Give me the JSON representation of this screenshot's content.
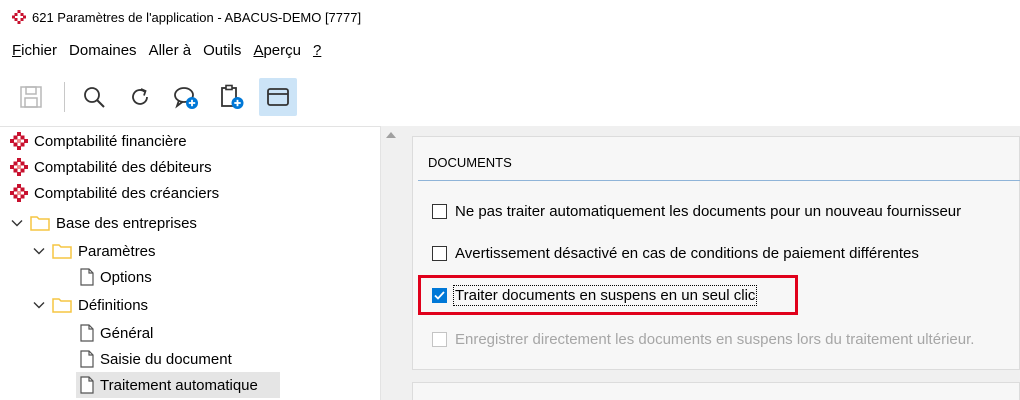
{
  "window": {
    "title": "621 Paramètres de l'application - ABACUS-DEMO [7777]"
  },
  "menu": [
    {
      "mnemonic": "F",
      "rest": "ichier"
    },
    {
      "mnemonic": "",
      "rest": "Domaines"
    },
    {
      "mnemonic": "",
      "rest": "Aller à"
    },
    {
      "mnemonic": "",
      "rest": "Outils"
    },
    {
      "mnemonic": "A",
      "rest": "perçu"
    },
    {
      "mnemonic": "?",
      "rest": ""
    }
  ],
  "toolbar": {
    "icons": [
      "save-icon",
      "search-icon",
      "refresh-icon",
      "add-comment-icon",
      "add-clipboard-icon",
      "window-icon"
    ],
    "active": "window-icon"
  },
  "tree": {
    "items": [
      {
        "label": "Comptabilité financière",
        "level": 0,
        "icon": "abacus-module-icon",
        "expander": "none"
      },
      {
        "label": "Comptabilité des débiteurs",
        "level": 0,
        "icon": "abacus-module-icon",
        "expander": "none"
      },
      {
        "label": "Comptabilité des créanciers",
        "level": 0,
        "icon": "abacus-module-icon",
        "expander": "none"
      },
      {
        "label": "Base des entreprises",
        "level": 0,
        "icon": "folder-icon",
        "expander": "expanded"
      },
      {
        "label": "Paramètres",
        "level": 1,
        "icon": "folder-icon",
        "expander": "expanded"
      },
      {
        "label": "Options",
        "level": 2,
        "icon": "page-icon",
        "expander": "none"
      },
      {
        "label": "Définitions",
        "level": 1,
        "icon": "folder-icon",
        "expander": "expanded"
      },
      {
        "label": "Général",
        "level": 2,
        "icon": "page-icon",
        "expander": "none"
      },
      {
        "label": "Saisie du document",
        "level": 2,
        "icon": "page-icon",
        "expander": "none"
      },
      {
        "label": "Traitement automatique",
        "level": 2,
        "icon": "page-icon",
        "expander": "none",
        "selected": true
      }
    ]
  },
  "documents": {
    "title": "DOCUMENTS",
    "options": [
      {
        "label": "Ne pas traiter automatiquement les documents pour un nouveau fournisseur",
        "checked": false,
        "enabled": true
      },
      {
        "label": "Avertissement désactivé en cas de conditions de paiement différentes",
        "checked": false,
        "enabled": true
      },
      {
        "label": "Traiter documents en suspens en un seul clic",
        "checked": true,
        "enabled": true,
        "highlighted": true
      },
      {
        "label": "Enregistrer directement les documents en suspens lors du traitement ultérieur.",
        "checked": false,
        "enabled": false
      }
    ]
  },
  "colors": {
    "accent": "#0078d7",
    "highlight": "#e0001b",
    "folder": "#f5c542",
    "abacus": "#c8102e"
  }
}
